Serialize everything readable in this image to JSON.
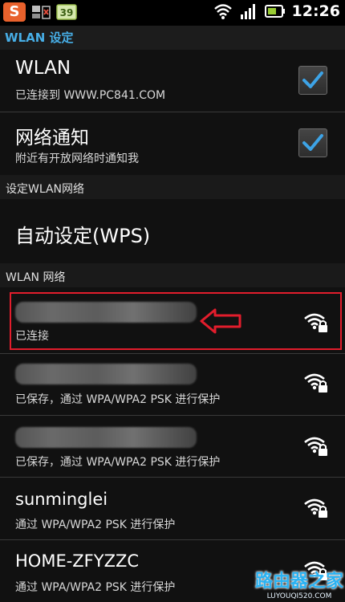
{
  "status_bar": {
    "time": "12:26",
    "battery_level_label": "39",
    "app_icon_letter": "S",
    "icons": [
      "sogou-input-icon",
      "sim-icon",
      "battery-level-icon",
      "wifi-signal-icon",
      "cell-signal-icon",
      "battery-icon"
    ]
  },
  "action_bar": {
    "title": "WLAN 设定"
  },
  "wlan": {
    "title": "WLAN",
    "summary": "已连接到 WWW.PC841.COM",
    "checked": true
  },
  "notify": {
    "title": "网络通知",
    "summary": "附近有开放网络时通知我",
    "checked": true
  },
  "setup_header": "设定WLAN网络",
  "wps": {
    "title": "自动设定(WPS)"
  },
  "networks_header": "WLAN 网络",
  "networks": [
    {
      "ssid": "",
      "ssid_blurred": true,
      "status": "已连接",
      "icon": "wifi-locked-icon"
    },
    {
      "ssid": "",
      "ssid_blurred": true,
      "status": "已保存，通过 WPA/WPA2 PSK 进行保护",
      "icon": "wifi-locked-icon"
    },
    {
      "ssid": "",
      "ssid_blurred": true,
      "status": "已保存，通过 WPA/WPA2 PSK 进行保护",
      "icon": "wifi-locked-icon"
    },
    {
      "ssid": "sunminglei",
      "ssid_blurred": false,
      "status": "通过 WPA/WPA2 PSK 进行保护",
      "icon": "wifi-locked-icon"
    },
    {
      "ssid": "HOME-ZFYZZC",
      "ssid_blurred": false,
      "status": "通过 WPA/WPA2 PSK 进行保护",
      "icon": "wifi-locked-icon"
    }
  ],
  "watermark": {
    "main": "路由器之家",
    "sub": "LUYOUQI520.COM"
  },
  "colors": {
    "accent": "#47aee6",
    "highlight": "#e21d2c",
    "check": "#3da3e6"
  }
}
